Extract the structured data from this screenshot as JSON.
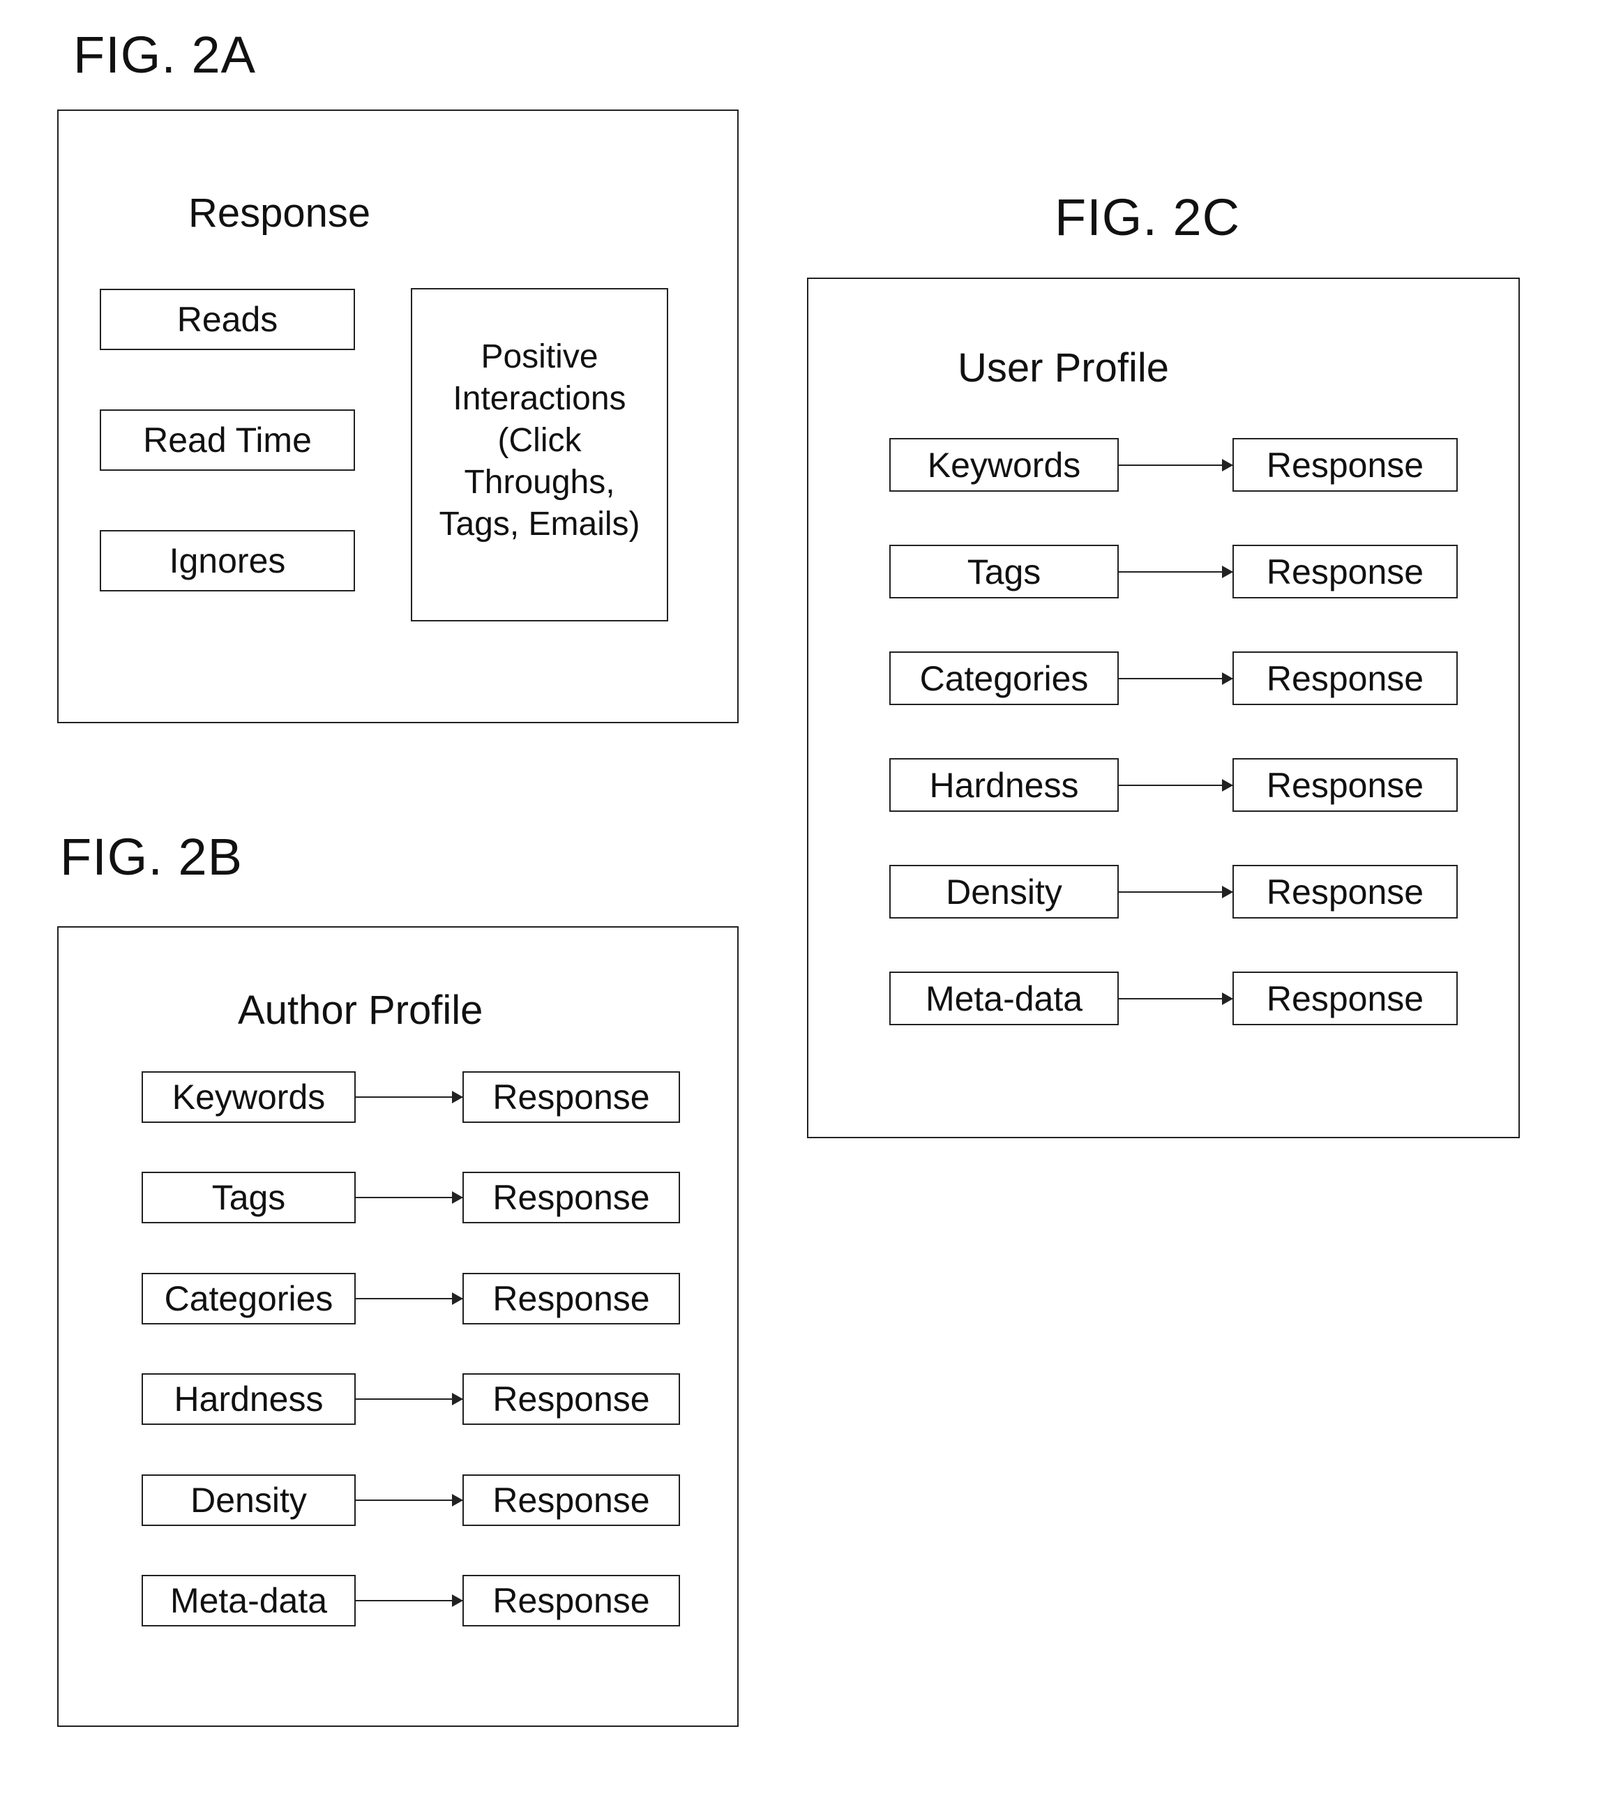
{
  "fig2a": {
    "label": "FIG. 2A",
    "title": "Response",
    "items": [
      "Reads",
      "Read Time",
      "Ignores"
    ],
    "positive_box_lines": [
      "Positive",
      "Interactions",
      "(Click",
      "Throughs,",
      "Tags, Emails)"
    ]
  },
  "fig2b": {
    "label": "FIG. 2B",
    "title": "Author Profile",
    "rows": [
      {
        "source": "Keywords",
        "target": "Response"
      },
      {
        "source": "Tags",
        "target": "Response"
      },
      {
        "source": "Categories",
        "target": "Response"
      },
      {
        "source": "Hardness",
        "target": "Response"
      },
      {
        "source": "Density",
        "target": "Response"
      },
      {
        "source": "Meta-data",
        "target": "Response"
      }
    ]
  },
  "fig2c": {
    "label": "FIG. 2C",
    "title": "User Profile",
    "rows": [
      {
        "source": "Keywords",
        "target": "Response"
      },
      {
        "source": "Tags",
        "target": "Response"
      },
      {
        "source": "Categories",
        "target": "Response"
      },
      {
        "source": "Hardness",
        "target": "Response"
      },
      {
        "source": "Density",
        "target": "Response"
      },
      {
        "source": "Meta-data",
        "target": "Response"
      }
    ]
  }
}
